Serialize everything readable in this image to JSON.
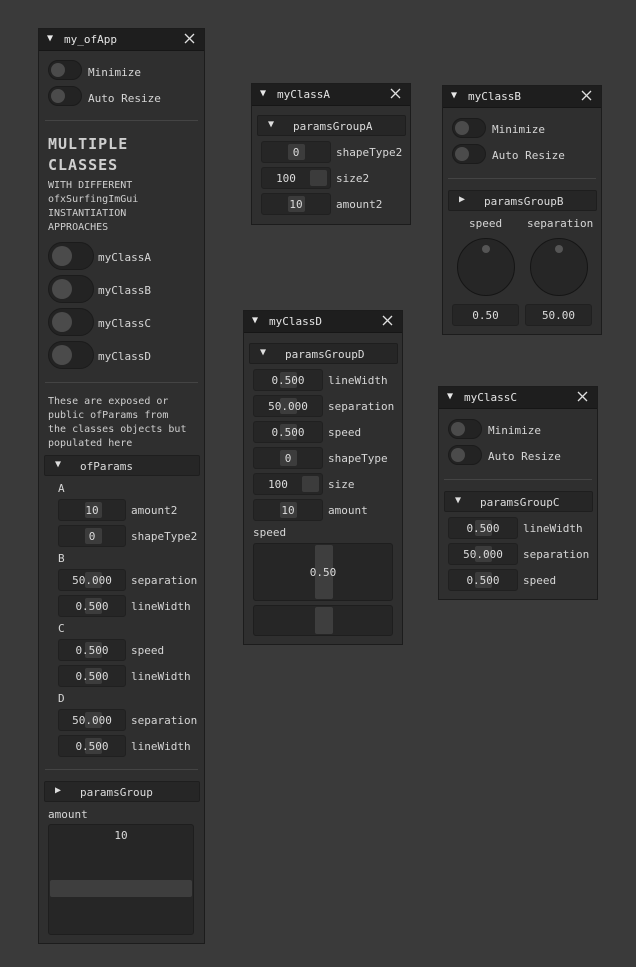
{
  "colors": {
    "background": "#3a3a3a",
    "window": "#2f2f2f",
    "titlebar": "#1e1e1e",
    "field": "#262626",
    "grab": "#3c3c3c",
    "text": "#d6d6d6"
  },
  "icons": {
    "collapse": "triangle-down-icon",
    "expand": "triangle-right-icon",
    "close": "close-icon"
  },
  "myApp": {
    "title": "my_ofApp",
    "minimize_label": "Minimize",
    "auto_resize_label": "Auto Resize",
    "heading_line1": "MULTIPLE",
    "heading_line2": "CLASSES",
    "sub_line1": "WITH DIFFERENT",
    "sub_line2": "ofxSurfingImGui",
    "sub_line3": "INSTANTIATION",
    "sub_line4": "APPROACHES",
    "toggles": [
      "myClassA",
      "myClassB",
      "myClassC",
      "myClassD"
    ],
    "note_line1": "These are exposed or",
    "note_line2": "public ofParams from",
    "note_line3": "the classes objects but",
    "note_line4": "populated here",
    "ofparams_label": "ofParams",
    "section_a": "A",
    "section_b": "B",
    "section_c": "C",
    "section_d": "D",
    "a_amount2_value": "10",
    "a_amount2_label": "amount2",
    "a_shape_value": "0",
    "a_shape_label": "shapeType2",
    "b_sep_value": "50.000",
    "b_sep_label": "separation",
    "b_lw_value": "0.500",
    "b_lw_label": "lineWidth",
    "c_speed_value": "0.500",
    "c_speed_label": "speed",
    "c_lw_value": "0.500",
    "c_lw_label": "lineWidth",
    "d_sep_value": "50.000",
    "d_sep_label": "separation",
    "d_lw_value": "0.500",
    "d_lw_label": "lineWidth",
    "params_group_label": "paramsGroup",
    "amount_label": "amount",
    "amount_value": "10"
  },
  "classA": {
    "title": "myClassA",
    "group_label": "paramsGroupA",
    "shape_value": "0",
    "shape_label": "shapeType2",
    "size_value": "100",
    "size_label": "size2",
    "amount_value": "10",
    "amount_label": "amount2"
  },
  "classB": {
    "title": "myClassB",
    "minimize_label": "Minimize",
    "auto_resize_label": "Auto Resize",
    "group_label": "paramsGroupB",
    "speed_label": "speed",
    "separation_label": "separation",
    "speed_value": "0.50",
    "separation_value": "50.00"
  },
  "classD": {
    "title": "myClassD",
    "group_label": "paramsGroupD",
    "lw_value": "0.500",
    "lw_label": "lineWidth",
    "sep_value": "50.000",
    "sep_label": "separation",
    "speed_value": "0.500",
    "speed_label": "speed",
    "shape_value": "0",
    "shape_label": "shapeType",
    "size_value": "100",
    "size_label": "size",
    "amount_value": "10",
    "amount_label": "amount",
    "speed_slider_label": "speed",
    "speed_slider_value": "0.50"
  },
  "classC": {
    "title": "myClassC",
    "minimize_label": "Minimize",
    "auto_resize_label": "Auto Resize",
    "group_label": "paramsGroupC",
    "lw_value": "0.500",
    "lw_label": "lineWidth",
    "sep_value": "50.000",
    "sep_label": "separation",
    "speed_value": "0.500",
    "speed_label": "speed"
  }
}
